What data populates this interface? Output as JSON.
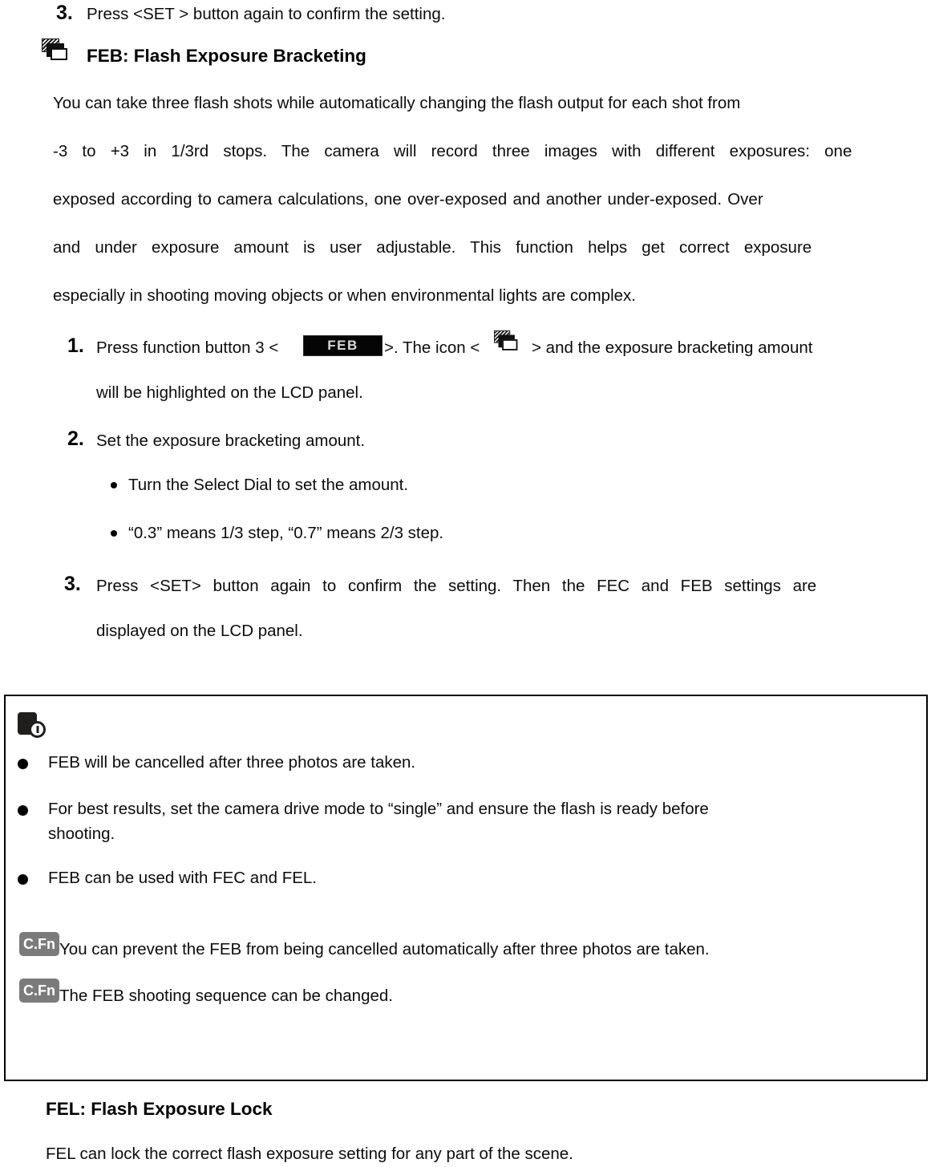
{
  "document": {
    "type": "camera-flash-manual-page",
    "steps_top": {
      "number": "3.",
      "text": "Press <SET > button again to confirm the setting."
    },
    "section_feb": {
      "icon": "flash-exposure-bracketing-icon",
      "heading": "FEB: Flash Exposure Bracketing",
      "paragraph_lines": [
        "You can take three flash shots while automatically changing the flash output for each shot from",
        "-3 to +3 in 1/3rd stops. The camera will record three images with different exposures: one",
        "exposed according to camera calculations, one over-exposed and another under-exposed. Over",
        "and under exposure amount is user adjustable. This function helps get correct exposure",
        "especially in shooting moving objects or when environmental lights are complex."
      ],
      "steps": [
        {
          "number": "1.",
          "text_before_button": "Press function button 3 <",
          "button_label": "FEB",
          "text_after_button": ">. The icon <",
          "icon": "flash-exposure-bracketing-icon",
          "text_after_icon": "> and the exposure bracketing amount",
          "continuation": "will be highlighted on the LCD panel."
        },
        {
          "number": "2.",
          "text": "Set the exposure bracketing amount.",
          "sub_bullets": [
            "Turn the Select Dial to set the amount.",
            "“0.3” means 1/3 step, “0.7” means 2/3 step."
          ]
        },
        {
          "number": "3.",
          "text": "Press <SET> button again to confirm the setting. Then the FEC and FEB settings are",
          "continuation": "displayed on the LCD panel."
        }
      ]
    },
    "note_box": {
      "icon": "note-info-icon",
      "bullets": [
        "FEB will be cancelled after three photos are taken.",
        "For best results, set the camera drive mode to “single” and ensure the flash is ready before",
        "FEB can be used with FEC and FEL."
      ],
      "bullet2_continuation": "shooting.",
      "cfn_items": [
        {
          "icon_label": "C.Fn",
          "text": "You can prevent the FEB from being cancelled automatically after three photos are taken."
        },
        {
          "icon_label": "C.Fn",
          "text": "The FEB shooting sequence can be changed."
        }
      ]
    },
    "section_fel": {
      "heading": "FEL: Flash Exposure Lock",
      "paragraph": "FEL can lock the correct flash exposure setting for any part of the scene."
    },
    "colors": {
      "text": "#0c0c0c",
      "button_bg": "#050505",
      "button_text": "#d8d8d8",
      "cfn_bg": "#7b7b7b",
      "cfn_text": "#ffffff",
      "note_border": "#000000"
    }
  }
}
